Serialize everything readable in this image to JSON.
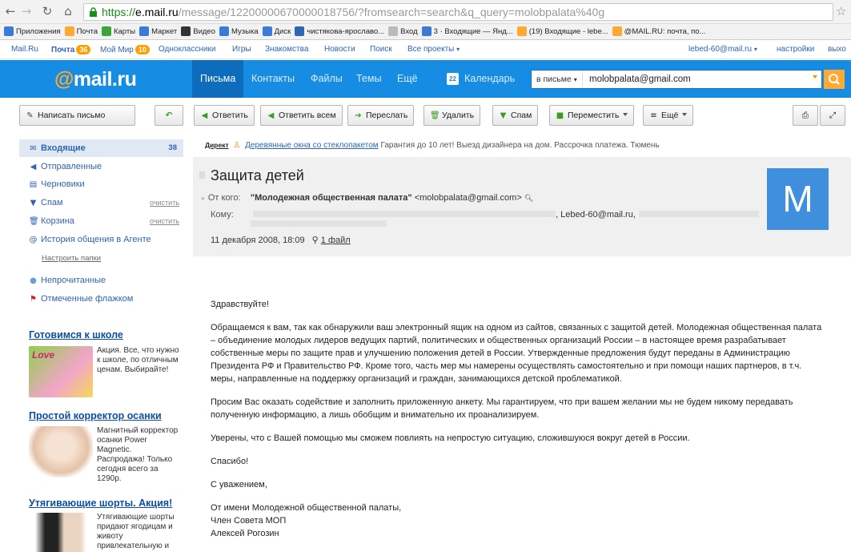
{
  "browser": {
    "url_scheme": "https://",
    "url_host": "e.mail.ru",
    "url_path": "/message/12200000670000018756/?fromsearch=search&q_query=molobpalata%40g",
    "url_tail": "...om_search=1",
    "back_icon": "back-arrow-icon",
    "forward_icon": "forward-arrow-icon",
    "reload_icon": "reload-icon",
    "home_icon": "home-icon"
  },
  "bookmarks": [
    {
      "label": "Приложения",
      "color": "#3b7bd8"
    },
    {
      "label": "Почта",
      "color": "#ffa930"
    },
    {
      "label": "Карты",
      "color": "#3aa63a"
    },
    {
      "label": "Маркет",
      "color": "#3b7bd8"
    },
    {
      "label": "Видео",
      "color": "#333333"
    },
    {
      "label": "Музыка",
      "color": "#3b7bd8"
    },
    {
      "label": "Диск",
      "color": "#3b7bd8"
    },
    {
      "label": "чистякова-ярославо...",
      "color": "#2f64b6"
    },
    {
      "label": "Вход",
      "color": "#bbbbbb"
    },
    {
      "label": "3 · Входящие — Янд...",
      "color": "#3b7bd8"
    },
    {
      "label": "(19) Входящие - lebe...",
      "color": "#ffa930"
    },
    {
      "label": "@MAIL.RU: почта, по...",
      "color": "#ffa930"
    }
  ],
  "portal": {
    "mailru": "Mail.Ru",
    "pochta": "Почта",
    "pochta_count": "36",
    "moimir": "Мой Мир",
    "moimir_count": "10",
    "odnoklassniki": "Одноклассники",
    "igry": "Игры",
    "znakomstva": "Знакомства",
    "novosti": "Новости",
    "poisk": "Поиск",
    "vse_proekty": "Все проекты",
    "user": "lebed-60@mail.ru",
    "settings": "настройки",
    "exit": "выхо"
  },
  "header": {
    "logo_at": "@",
    "logo_text": "mail.ru",
    "nav": [
      "Письма",
      "Контакты",
      "Файлы",
      "Темы",
      "Ещё"
    ],
    "calendar_num": "22",
    "calendar": "Календарь",
    "search_scope": "в письме",
    "search_value": "molobpalata@gmail.com"
  },
  "toolbar": {
    "compose": "Написать письмо",
    "reply": "Ответить",
    "reply_all": "Ответить всем",
    "forward": "Переслать",
    "delete": "Удалить",
    "spam": "Спам",
    "move": "Переместить",
    "more": "Ещё"
  },
  "sidebar": {
    "inbox": "Входящие",
    "inbox_count": "38",
    "sent": "Отправленные",
    "drafts": "Черновики",
    "spam": "Спам",
    "trash": "Корзина",
    "clean": "очистить",
    "agent": "История общения в Агенте",
    "setup": "Настроить папки",
    "unread": "Непрочитанные",
    "flagged": "Отмеченные флажком"
  },
  "ads": [
    {
      "title": "Готовимся к школе",
      "text": "Акция. Все, что нужно к школе, по отличным ценам. Выбирайте!",
      "img_text": "Love"
    },
    {
      "title": "Простой корректор осанки",
      "text": "Магнитный корректор осанки Power Magnetic. Распродажа! Только сегодня всего за 1290р."
    },
    {
      "title": "Утягивающие шорты. Акция!",
      "text": "Утягивающие шорты придают ягодицам и животу привлекательную и"
    }
  ],
  "direct": {
    "label": "Директ",
    "link": "Деревянные окна со стеклопакетом",
    "text": "Гарантия до 10 лет! Выезд дизайнера на дом. Рассрочка платежа. Тюмень"
  },
  "message": {
    "subject": "Защита детей",
    "from_label": "От кого:",
    "from_name": "\"Молодежная общественная палата\"",
    "from_email": "<molobpalata@gmail.com>",
    "to_label": "Кому:",
    "to_visible": ", Lebed-60@mail.ru,",
    "date": "11 декабря 2008, 18:09",
    "attach": "1 файл",
    "avatar_letter": "M",
    "body": [
      "Здравствуйте!",
      "Обращаемся к вам, так как обнаружили ваш электронный ящик на одном из сайтов, связанных с защитой детей. Молодежная общественная палата – объединение молодых лидеров ведущих партий, политических и общественных организаций России – в настоящее время разрабатывает собственные меры по защите прав и улучшению положения детей в России. Утвержденные предложения будут переданы в Администрацию Президента РФ и Правительство РФ. Кроме того, часть мер мы намерены осуществлять самостоятельно и при помощи наших партнеров, в т.ч. меры, направленные на поддержку организаций и граждан, занимающихся детской проблематикой.",
      "Просим Вас оказать содействие и заполнить приложенную анкету. Мы гарантируем, что при вашем желании мы не будем никому передавать полученную информацию, а лишь обобщим и внимательно их проанализируем.",
      "Уверены, что с Вашей помощью мы сможем повлиять на непростую ситуацию, сложившуюся вокруг детей в России.",
      "Спасибо!"
    ],
    "signature": [
      "С уважением,",
      "От имени Молодежной общественной палаты,",
      "Член Совета МОП",
      "Алексей Рогозин"
    ]
  }
}
